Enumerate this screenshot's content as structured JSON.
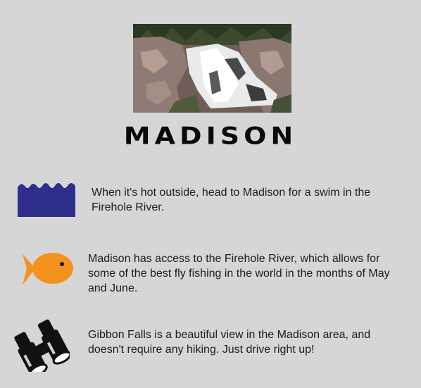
{
  "title": "MADISON",
  "hero": {
    "icon": "waterfall-photo"
  },
  "activities": [
    {
      "icon": "water-waves-icon",
      "text": "When it's hot outside, head to Madison for a swim in the Firehole River."
    },
    {
      "icon": "fish-icon",
      "text": "Madison has access to the Firehole River, which allows for some of the best fly fishing in the world in the months of May and June."
    },
    {
      "icon": "binoculars-icon",
      "text": "Gibbon Falls is a beautiful view in the Madison area, and doesn't require any hiking. Just drive right up!"
    }
  ],
  "colors": {
    "background": "#d6d6d6",
    "water": "#2e2f8c",
    "fish": "#f5921e",
    "binoculars": "#111111"
  }
}
